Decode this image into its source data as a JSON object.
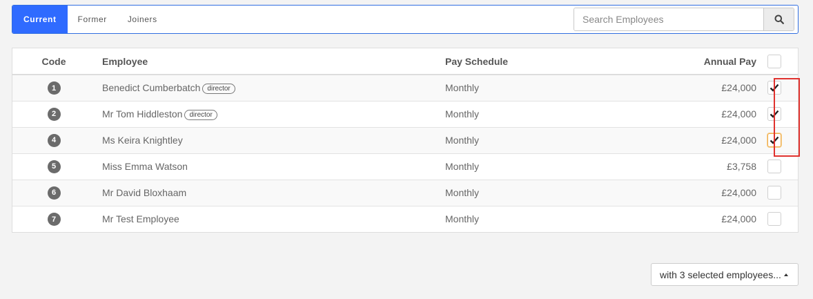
{
  "tabs": [
    {
      "label": "Current",
      "active": true
    },
    {
      "label": "Former",
      "active": false
    },
    {
      "label": "Joiners",
      "active": false
    }
  ],
  "search": {
    "placeholder": "Search Employees",
    "icon": "search-icon"
  },
  "table": {
    "headers": {
      "code": "Code",
      "employee": "Employee",
      "pay_schedule": "Pay Schedule",
      "annual_pay": "Annual Pay"
    },
    "rows": [
      {
        "code": "1",
        "name": "Benedict Cumberbatch",
        "badge": "director",
        "schedule": "Monthly",
        "pay": "£24,000",
        "selected": true
      },
      {
        "code": "2",
        "name": "Mr Tom Hiddleston",
        "badge": "director",
        "schedule": "Monthly",
        "pay": "£24,000",
        "selected": true
      },
      {
        "code": "4",
        "name": "Ms Keira Knightley",
        "badge": "",
        "schedule": "Monthly",
        "pay": "£24,000",
        "selected": true
      },
      {
        "code": "5",
        "name": "Miss Emma Watson",
        "badge": "",
        "schedule": "Monthly",
        "pay": "£3,758",
        "selected": false
      },
      {
        "code": "6",
        "name": "Mr David Bloxhaam",
        "badge": "",
        "schedule": "Monthly",
        "pay": "£24,000",
        "selected": false
      },
      {
        "code": "7",
        "name": "Mr Test Employee",
        "badge": "",
        "schedule": "Monthly",
        "pay": "£24,000",
        "selected": false
      }
    ]
  },
  "bulk_action": {
    "label": "with 3 selected employees..."
  },
  "colors": {
    "accent": "#2f6bff",
    "highlight": "#e0312d",
    "focus": "#f0ad4e"
  }
}
